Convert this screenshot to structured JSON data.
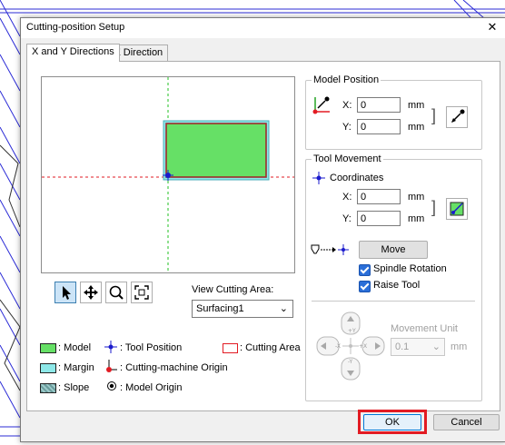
{
  "window": {
    "title": "Cutting-position Setup"
  },
  "tabs": [
    {
      "label": "X and Y Directions"
    },
    {
      "label": "Z Direction"
    }
  ],
  "model_position": {
    "title": "Model Position",
    "x_label": "X:",
    "x_value": "0",
    "x_unit": "mm",
    "y_label": "Y:",
    "y_value": "0",
    "y_unit": "mm"
  },
  "tool_movement": {
    "title": "Tool Movement",
    "coordinates_label": "Coordinates",
    "x_label": "X:",
    "x_value": "0",
    "x_unit": "mm",
    "y_label": "Y:",
    "y_value": "0",
    "y_unit": "mm",
    "move_label": "Move",
    "spindle_rotation": {
      "label": "Spindle Rotation",
      "checked": true
    },
    "raise_tool": {
      "label": "Raise Tool",
      "checked": true
    },
    "movement_unit_label": "Movement Unit",
    "movement_unit_value": "0.1",
    "movement_unit_suffix": "mm",
    "jog_labels": {
      "up": "+Y",
      "down": "-Y",
      "left": "-X",
      "right": "+X"
    }
  },
  "view_cutting_area": {
    "label": "View Cutting Area:",
    "value": "Surfacing1"
  },
  "legend": {
    "model": ": Model",
    "margin": ": Margin",
    "slope": ": Slope",
    "tool_position": ": Tool Position",
    "cutting_machine_origin": ": Cutting-machine Origin",
    "model_origin": ": Model Origin",
    "cutting_area": ": Cutting Area"
  },
  "footer": {
    "ok_label": "OK",
    "cancel_label": "Cancel"
  },
  "colors": {
    "model": "#66e066",
    "margin": "#8de8e8",
    "slope": "#7fb0b0",
    "highlight": "#e21b23",
    "tool": "#1a1acc"
  }
}
